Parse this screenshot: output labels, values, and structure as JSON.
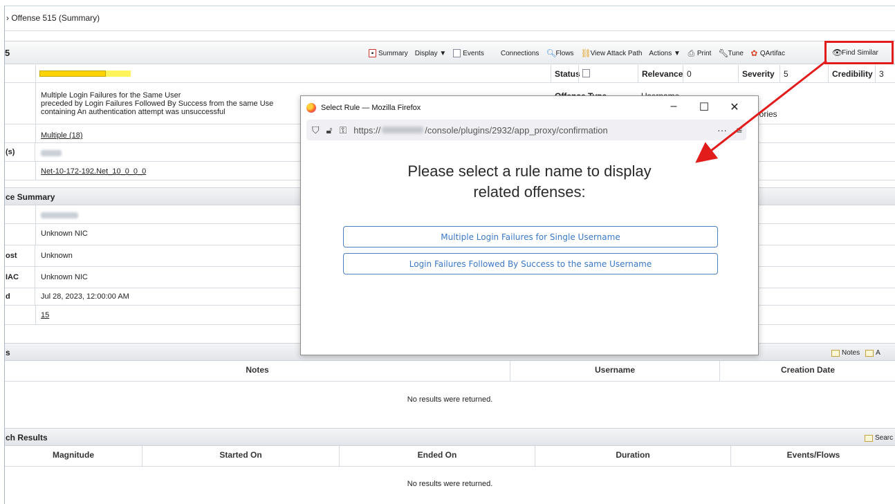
{
  "breadcrumb": "› Offense 515 (Summary)",
  "toolbar": {
    "title_fragment": "5",
    "summary": "Summary",
    "display": "Display ▼",
    "events": "Events",
    "connections": "Connections",
    "flows": "Flows",
    "attack_path": "View Attack Path",
    "actions": "Actions ▼",
    "print": "Print",
    "tune": "Tune",
    "qartifact": "QArtifac",
    "find_similar": "Find Similar"
  },
  "offense": {
    "magnitude_bar": "",
    "status_label": "Status",
    "relevance_label": "Relevance",
    "relevance_value": "0",
    "severity_label": "Severity",
    "severity_value": "5",
    "credibility_label": "Credibility",
    "credibility_value": "3",
    "description_1": "Multiple Login Failures for the Same User",
    "description_2": "preceded by Login Failures Followed By Success from the same Use",
    "description_3": "containing An authentication attempt was unsuccessful",
    "offense_type_label": "Offense Type",
    "offense_type_value": "Username",
    "categories_fragment": "jories",
    "multiple_link": "Multiple (18)",
    "ip_label": "(s)",
    "network_link": "Net-10-172-192.Net_10_0_0_0"
  },
  "source_summary": {
    "header": "ce Summary",
    "rows": [
      {
        "label": "",
        "value": ""
      },
      {
        "label": "",
        "value": "Unknown NIC"
      },
      {
        "label": "ost",
        "value": "Unknown"
      },
      {
        "label": "IAC",
        "value": "Unknown NIC"
      },
      {
        "label": "d",
        "value": "Jul 28, 2023, 12:00:00 AM"
      },
      {
        "label": "",
        "value": "15"
      }
    ]
  },
  "notes": {
    "header": "s",
    "notes_btn": "Notes",
    "add_btn": "A",
    "cols": [
      "Notes",
      "Username",
      "Creation Date"
    ],
    "empty": "No results were returned."
  },
  "search": {
    "header": "ch Results",
    "search_btn": "Searc",
    "cols": [
      "Magnitude",
      "Started On",
      "Ended On",
      "Duration",
      "Events/Flows"
    ],
    "empty": "No results were returned."
  },
  "dialog": {
    "window_title": "Select Rule — Mozilla Firefox",
    "url_prefix": "https://",
    "url_suffix": "/console/plugins/2932/app_proxy/confirmation",
    "heading_1": "Please select a rule name to display",
    "heading_2": "related offenses:",
    "rule_1": "Multiple Login Failures for Single Username",
    "rule_2": "Login Failures Followed By Success to the same Username"
  },
  "colors": {
    "highlight": "#e21b1b",
    "link_blue": "#3a78c8",
    "magnitude": "#ffd400"
  }
}
